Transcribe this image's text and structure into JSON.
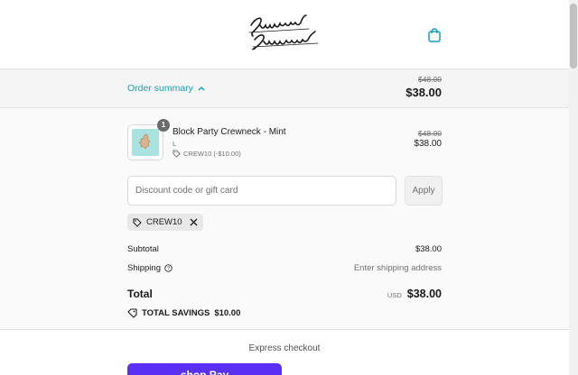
{
  "header": {
    "logo_text": "Sunday Swagger",
    "cart_icon": "shopping-bag-icon"
  },
  "summary_bar": {
    "toggle_label": "Order summary",
    "old_total": "$48.00",
    "total": "$38.00"
  },
  "product": {
    "quantity": "1",
    "name": "Block Party Crewneck - Mint",
    "variant": "L",
    "discount": "CREW10 (-$10.00)",
    "old_price": "$48.00",
    "price": "$38.00"
  },
  "discount_form": {
    "placeholder": "Discount code or gift card",
    "apply_label": "Apply",
    "applied_code": "CREW10"
  },
  "totals": {
    "subtotal_label": "Subtotal",
    "subtotal_value": "$38.00",
    "shipping_label": "Shipping",
    "shipping_value": "Enter shipping address",
    "total_label": "Total",
    "currency": "USD",
    "total_value": "$38.00",
    "savings_label": "TOTAL SAVINGS",
    "savings_value": "$10.00"
  },
  "express": {
    "title": "Express checkout",
    "shop_pay_label": "shop Pay"
  },
  "colors": {
    "accent": "#1a9eb5",
    "shop_pay": "#5a31f4"
  }
}
